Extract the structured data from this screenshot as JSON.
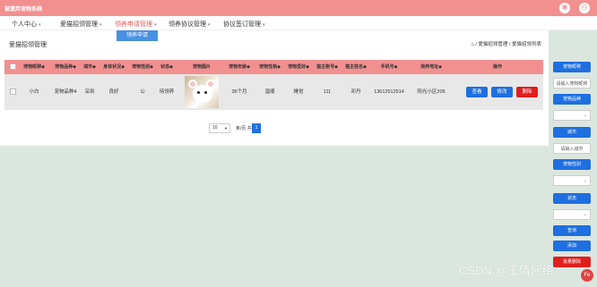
{
  "app": {
    "title": "被遗弃宠物系统"
  },
  "header_icons": {
    "settings_icon": "✻",
    "user_icon": "⚇"
  },
  "nav": {
    "items": [
      {
        "label": "个人中心"
      },
      {
        "label": "爱猫招领管理"
      },
      {
        "label": "领养申请管理"
      },
      {
        "label": "领养协议管理"
      },
      {
        "label": "协议签订管理"
      }
    ],
    "dropdown": {
      "label": "领养申请"
    }
  },
  "page": {
    "title": "爱猫招领管理",
    "breadcrumb": "⌂ / 爱猫招领管理 / 爱猫招领列表"
  },
  "table": {
    "headers": [
      "宠物昵称◆",
      "宠物品种◆",
      "城市◆",
      "身体状况◆",
      "宠物性别◆",
      "状态◆",
      "宠物图片",
      "宠物年龄◆",
      "宠物性格◆",
      "宠物爱好◆",
      "猫主账号◆",
      "猫主姓名◆",
      "手机号◆",
      "领养地址◆",
      "操作"
    ],
    "rows": [
      {
        "cells": [
          "小白",
          "宠物品种4",
          "深圳",
          "良好",
          "公",
          "待领养",
          "",
          "36个月",
          "温顺",
          "睡觉",
          "111",
          "邓丹",
          "13612512514",
          "阳光小区205"
        ]
      }
    ],
    "actions": {
      "view": "查看",
      "edit": "修改",
      "delete": "删除"
    }
  },
  "pager": {
    "page_size": "10",
    "jump_label": "条/页 共",
    "current_page": "1"
  },
  "side": {
    "pet_name_label": "宠物昵称",
    "pet_name_placeholder": "请输入宠物昵称",
    "breed_label": "宠物品种",
    "city_label": "城市",
    "city_placeholder": "请输入城市",
    "gender_label": "宠物性别",
    "status_label": "状态",
    "search": "查询",
    "add": "添加",
    "batch_delete": "批量删除"
  },
  "watermark": "CSDN @王倩网络",
  "colors": {
    "accent": "#f29090",
    "primary": "#1e6fe0",
    "danger": "#e01e1e"
  }
}
